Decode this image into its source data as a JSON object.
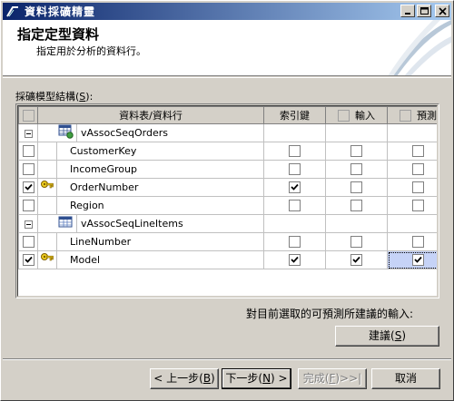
{
  "window": {
    "title": "資料採礦精靈",
    "caption_buttons": [
      "minimize-icon",
      "maximize-icon",
      "close-icon"
    ]
  },
  "header": {
    "title": "指定定型資料",
    "subtitle": "指定用於分析的資料行。"
  },
  "grid": {
    "label": "採礦模型結構(",
    "label_key": "S",
    "label_end": "):",
    "columns": {
      "table_column": "資料表/資料行",
      "key": "索引鍵",
      "input": "輸入",
      "predict": "預測"
    },
    "rows": [
      {
        "type": "table",
        "name": "vAssocSeqOrders",
        "icon": "table-icon"
      },
      {
        "type": "column",
        "name": "CustomerKey",
        "key": false,
        "input": false,
        "predict": false,
        "include": false,
        "icon": ""
      },
      {
        "type": "column",
        "name": "IncomeGroup",
        "key": false,
        "input": false,
        "predict": false,
        "include": false,
        "icon": ""
      },
      {
        "type": "column",
        "name": "OrderNumber",
        "key": true,
        "input": false,
        "predict": false,
        "include": true,
        "icon": "key-icon"
      },
      {
        "type": "column",
        "name": "Region",
        "key": false,
        "input": false,
        "predict": false,
        "include": false,
        "icon": ""
      },
      {
        "type": "table",
        "name": "vAssocSeqLineItems",
        "icon": "nested-table-icon"
      },
      {
        "type": "column",
        "name": "LineNumber",
        "key": false,
        "input": false,
        "predict": false,
        "include": false,
        "icon": ""
      },
      {
        "type": "column",
        "name": "Model",
        "key": true,
        "input": true,
        "predict": true,
        "include": true,
        "icon": "key-icon",
        "selected_cell": "predict"
      }
    ]
  },
  "suggest": {
    "text": "對目前選取的可預測所建議的輸入:",
    "button": "建議(",
    "button_key": "S",
    "button_end": ")"
  },
  "buttons": {
    "back": "< 上一步(",
    "back_key": "B",
    "back_end": ")",
    "next": "下一步(",
    "next_key": "N",
    "next_end": ") >",
    "finish": "完成(",
    "finish_key": "F",
    "finish_end": ")>>|",
    "cancel": "取消"
  },
  "colors": {
    "title_gradient_start": "#0a246a",
    "title_gradient_end": "#a6caf0",
    "selected_cell": "#c6d3f7",
    "dialog_bg": "#d4d0c8"
  }
}
